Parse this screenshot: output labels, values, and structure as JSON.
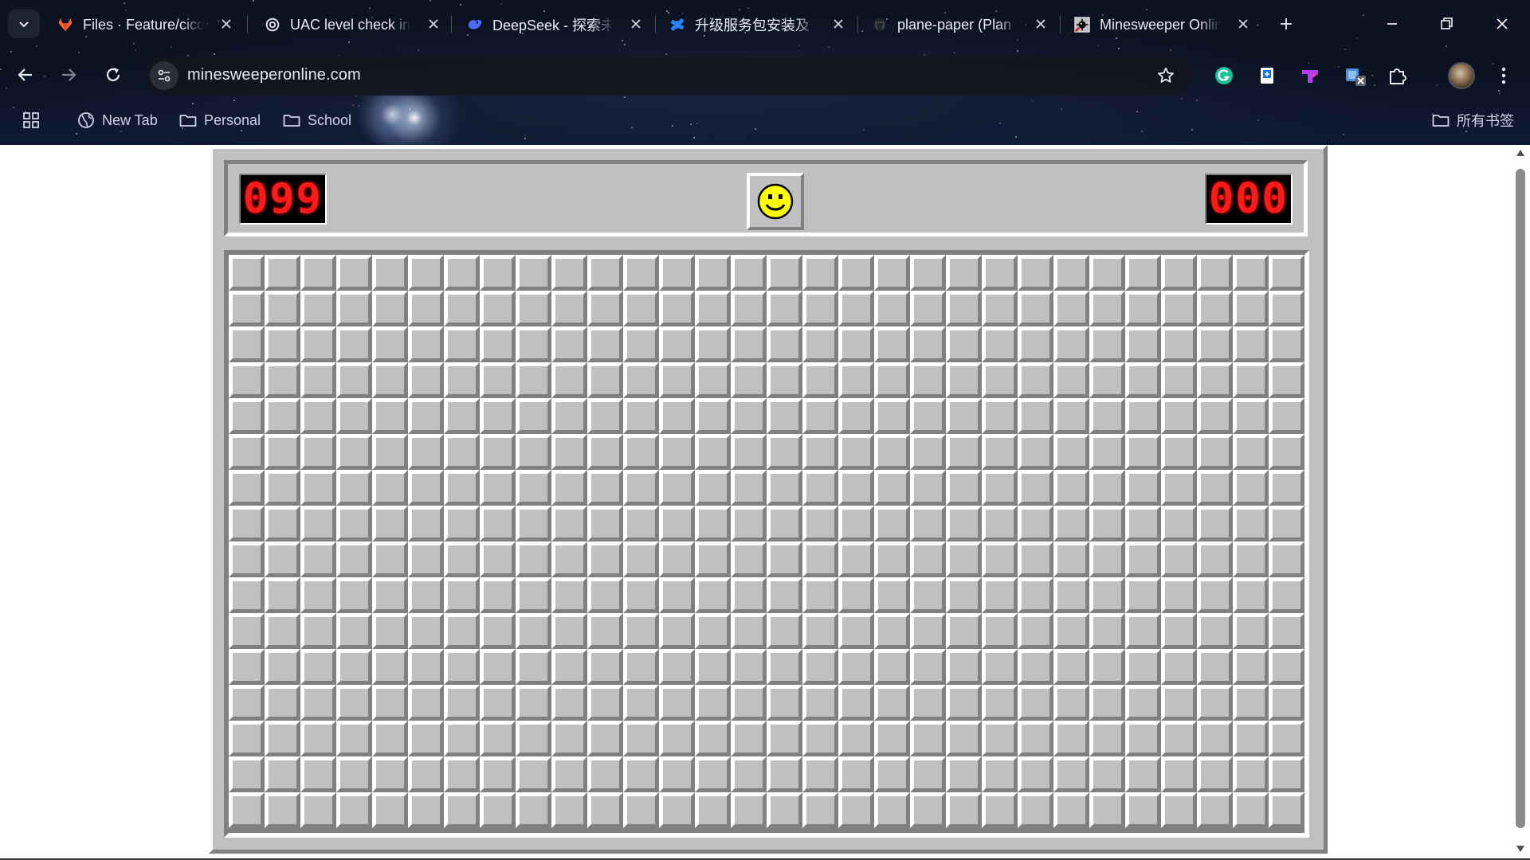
{
  "browser": {
    "tabs": [
      {
        "title": "Files · Feature/cicd",
        "icon": "gitlab-icon",
        "active": false
      },
      {
        "title": "UAC level check in",
        "icon": "openai-icon",
        "active": false
      },
      {
        "title": "DeepSeek - 探索未",
        "icon": "deepseek-icon",
        "active": false
      },
      {
        "title": "升级服务包安装及",
        "icon": "confluence-icon",
        "active": false
      },
      {
        "title": "plane-paper (Plan",
        "icon": "github-icon",
        "active": false
      },
      {
        "title": "Minesweeper Online",
        "icon": "minesweeper-icon",
        "active": true
      }
    ],
    "address": {
      "url": "minesweeperonline.com"
    },
    "bookmarks": [
      {
        "label": "New Tab",
        "icon": "globe-icon"
      },
      {
        "label": "Personal",
        "icon": "folder-icon"
      },
      {
        "label": "School",
        "icon": "folder-icon"
      }
    ],
    "all_bookmarks_label": "所有书签",
    "extensions": [
      "grammarly-icon",
      "translate-extension-icon",
      "purple-t-extension-icon",
      "excel-extension-icon",
      "puzzle-extensions-icon"
    ]
  },
  "game": {
    "mines_remaining": "099",
    "timer": "000",
    "face": "smiley-face-icon",
    "board": {
      "columns": 30,
      "rows": 16,
      "state": "all-covered"
    }
  },
  "colors": {
    "panel_gray": "#c0c0c0",
    "bevel_light": "#ffffff",
    "bevel_dark": "#808080",
    "led_red": "#ff1a1a"
  }
}
